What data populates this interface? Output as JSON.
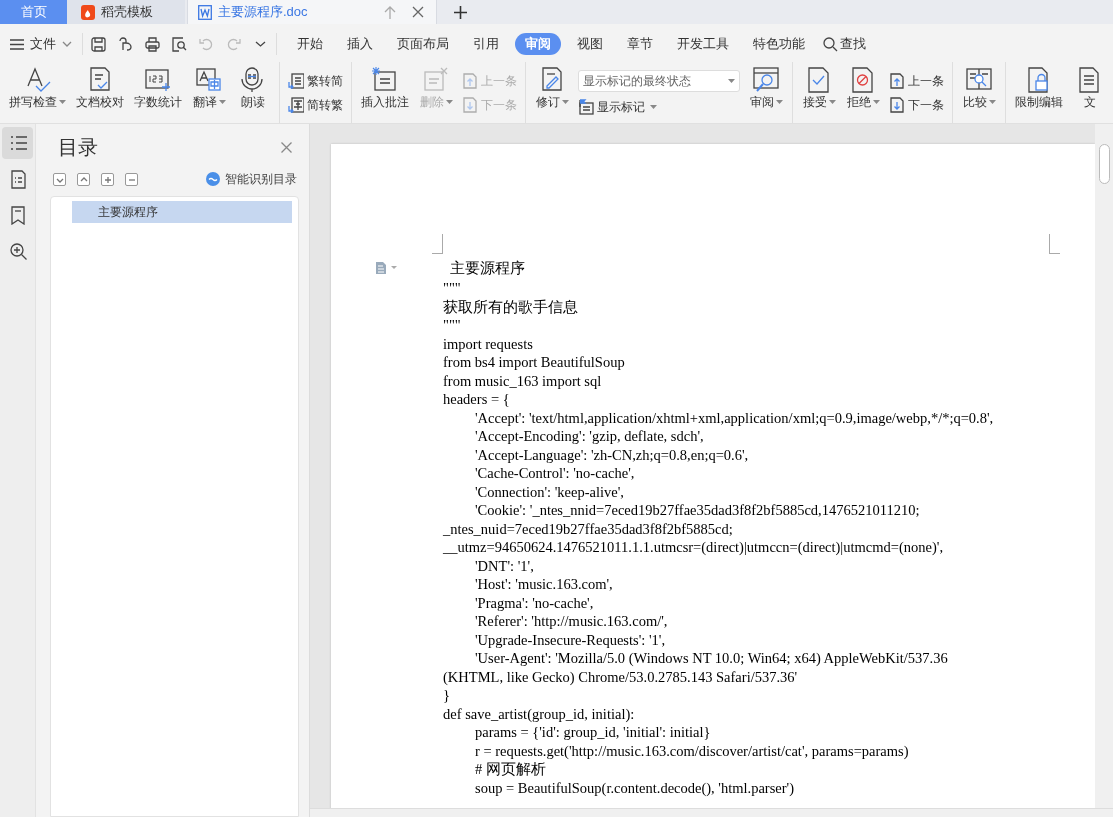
{
  "tabs": [
    {
      "label": "首页",
      "kind": "home",
      "selected": false
    },
    {
      "label": "稻壳模板",
      "kind": "template",
      "selected": false
    },
    {
      "label": "主要源程序.doc",
      "kind": "document",
      "selected": true
    }
  ],
  "menu": {
    "file": "文件",
    "items": [
      {
        "label": "开始",
        "selected": false
      },
      {
        "label": "插入",
        "selected": false
      },
      {
        "label": "页面布局",
        "selected": false
      },
      {
        "label": "引用",
        "selected": false
      },
      {
        "label": "审阅",
        "selected": true
      },
      {
        "label": "视图",
        "selected": false
      },
      {
        "label": "章节",
        "selected": false
      },
      {
        "label": "开发工具",
        "selected": false
      },
      {
        "label": "特色功能",
        "selected": false
      }
    ],
    "search": "查找"
  },
  "ribbon": [
    {
      "items": [
        {
          "label": "拼写检查",
          "kind": "large",
          "dropdown": true,
          "disabled": false
        },
        {
          "label": "文档校对",
          "kind": "large",
          "dropdown": false,
          "disabled": false
        },
        {
          "label": "字数统计",
          "kind": "large",
          "dropdown": false,
          "disabled": false
        },
        {
          "label": "翻译",
          "kind": "large",
          "dropdown": true,
          "disabled": false
        },
        {
          "label": "朗读",
          "kind": "large",
          "dropdown": false,
          "disabled": false
        }
      ]
    },
    {
      "items": [
        {
          "label": "繁转简",
          "kind": "small",
          "dropdown": false,
          "disabled": false
        },
        {
          "label": "简转繁",
          "kind": "small",
          "dropdown": false,
          "disabled": false
        }
      ]
    },
    {
      "items": [
        {
          "label": "插入批注",
          "kind": "large",
          "dropdown": false,
          "disabled": false
        },
        {
          "label": "删除",
          "kind": "large",
          "dropdown": true,
          "disabled": true
        },
        {
          "label": "上一条",
          "kind": "small",
          "dropdown": false,
          "disabled": true
        },
        {
          "label": "下一条",
          "kind": "small",
          "dropdown": false,
          "disabled": true
        }
      ]
    },
    {
      "items": [
        {
          "label": "修订",
          "kind": "large",
          "dropdown": true,
          "disabled": false
        },
        {
          "label": "显示标记的最终状态",
          "kind": "select",
          "dropdown": true,
          "disabled": false
        },
        {
          "label": "显示标记",
          "kind": "small",
          "dropdown": true,
          "disabled": false
        },
        {
          "label": "审阅",
          "kind": "large",
          "dropdown": true,
          "disabled": false
        }
      ]
    },
    {
      "items": [
        {
          "label": "接受",
          "kind": "large",
          "dropdown": true,
          "disabled": false
        },
        {
          "label": "拒绝",
          "kind": "large",
          "dropdown": true,
          "disabled": false
        },
        {
          "label": "上一条",
          "kind": "small",
          "dropdown": false,
          "disabled": false
        },
        {
          "label": "下一条",
          "kind": "small",
          "dropdown": false,
          "disabled": false
        }
      ]
    },
    {
      "items": [
        {
          "label": "比较",
          "kind": "large",
          "dropdown": true,
          "disabled": false
        }
      ]
    },
    {
      "items": [
        {
          "label": "限制编辑",
          "kind": "large",
          "dropdown": false,
          "disabled": false
        },
        {
          "label": "文",
          "kind": "large",
          "dropdown": false,
          "disabled": false
        }
      ]
    }
  ],
  "toc": {
    "title": "目录",
    "smart": "智能识别目录",
    "items": [
      {
        "label": "主要源程序",
        "selected": true
      }
    ]
  },
  "document": {
    "heading": "主要源程序",
    "lines": [
      {
        "text": "\"\"\"",
        "kind": "plain"
      },
      {
        "text": "获取所有的歌手信息",
        "kind": "plain"
      },
      {
        "text": "\"\"\"",
        "kind": "plain"
      },
      {
        "text": "import requests",
        "kind": "plain"
      },
      {
        "text": "from bs4 import BeautifulSoup",
        "kind": "plain"
      },
      {
        "text": "from music_163 import sql",
        "kind": "plain"
      },
      {
        "text": "headers = {",
        "kind": "plain"
      },
      {
        "text": "'Accept': 'text/html,application/xhtml+xml,application/xml;q=0.9,image/webp,*/*;q=0.8',",
        "kind": "indented"
      },
      {
        "text": "'Accept-Encoding': 'gzip, deflate, sdch',",
        "kind": "indented"
      },
      {
        "text": "'Accept-Language': 'zh-CN,zh;q=0.8,en;q=0.6',",
        "kind": "indented"
      },
      {
        "text": "'Cache-Control': 'no-cache',",
        "kind": "indented"
      },
      {
        "text": "'Connection': 'keep-alive',",
        "kind": "indented"
      },
      {
        "text": "'Cookie': '_ntes_nnid=7eced19b27ffae35dad3f8f2bf5885cd,1476521011210;",
        "kind": "indented"
      },
      {
        "text": "_ntes_nuid=7eced19b27ffae35dad3f8f2bf5885cd;",
        "kind": "plain"
      },
      {
        "text": "__utmz=94650624.1476521011.1.1.utmcsr=(direct)|utmccn=(direct)|utmcmd=(none)',",
        "kind": "plain"
      },
      {
        "text": "'DNT': '1',",
        "kind": "indented"
      },
      {
        "text": "'Host': 'music.163.com',",
        "kind": "indented"
      },
      {
        "text": "'Pragma': 'no-cache',",
        "kind": "indented"
      },
      {
        "text": "'Referer': 'http://music.163.com/',",
        "kind": "indented"
      },
      {
        "text": "'Upgrade-Insecure-Requests': '1',",
        "kind": "indented"
      },
      {
        "text": "'User-Agent': 'Mozilla/5.0 (Windows NT 10.0; Win64; x64) AppleWebKit/537.36",
        "kind": "indented"
      },
      {
        "text": "(KHTML, like Gecko) Chrome/53.0.2785.143 Safari/537.36'",
        "kind": "plain"
      },
      {
        "text": "}",
        "kind": "plain"
      },
      {
        "text": "def save_artist(group_id, initial):",
        "kind": "plain"
      },
      {
        "text": "params = {'id': group_id, 'initial': initial}",
        "kind": "indented"
      },
      {
        "text": "r = requests.get('http://music.163.com/discover/artist/cat', params=params)",
        "kind": "indented"
      },
      {
        "text": "# 网页解析",
        "kind": "indented"
      },
      {
        "text": "soup = BeautifulSoup(r.content.decode(), 'html.parser')",
        "kind": "indented"
      }
    ]
  }
}
